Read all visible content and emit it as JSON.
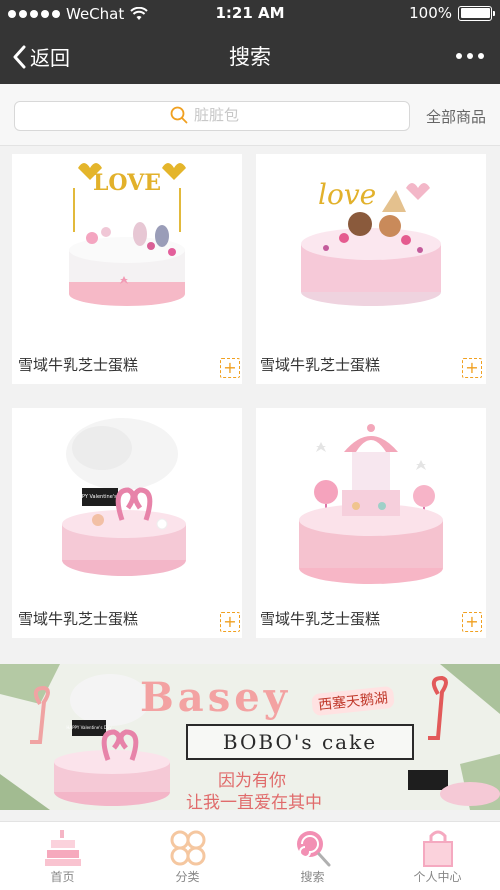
{
  "status_bar": {
    "carrier": "WeChat",
    "time": "1:21 AM",
    "battery": "100%"
  },
  "nav": {
    "back_label": "返回",
    "title": "搜索"
  },
  "search": {
    "placeholder": "脏脏包",
    "all_goods_label": "全部商品"
  },
  "products": [
    {
      "name": "雪域牛乳芝士蛋糕",
      "topper_text": "LOVE"
    },
    {
      "name": "雪域牛乳芝士蛋糕",
      "topper_text": "love"
    },
    {
      "name": "雪域牛乳芝士蛋糕",
      "topper_text": "HAPPY Valentine's Day"
    },
    {
      "name": "雪域牛乳芝士蛋糕"
    }
  ],
  "banner": {
    "title": "Basey",
    "subtitle": "西塞天鹅湖",
    "box_text": "BOBO's cake",
    "line1": "因为有你",
    "line2": "让我一直爱在其中",
    "topper_text": "HAPPY Valentine's Day"
  },
  "tabbar": [
    {
      "label": "首页",
      "icon": "cake-icon"
    },
    {
      "label": "分类",
      "icon": "category-icon"
    },
    {
      "label": "搜索",
      "icon": "lollipop-icon"
    },
    {
      "label": "个人中心",
      "icon": "gift-bag-icon"
    }
  ],
  "colors": {
    "nav_bg": "#353535",
    "accent": "#f0a020",
    "pink": "#f3a2a2"
  }
}
